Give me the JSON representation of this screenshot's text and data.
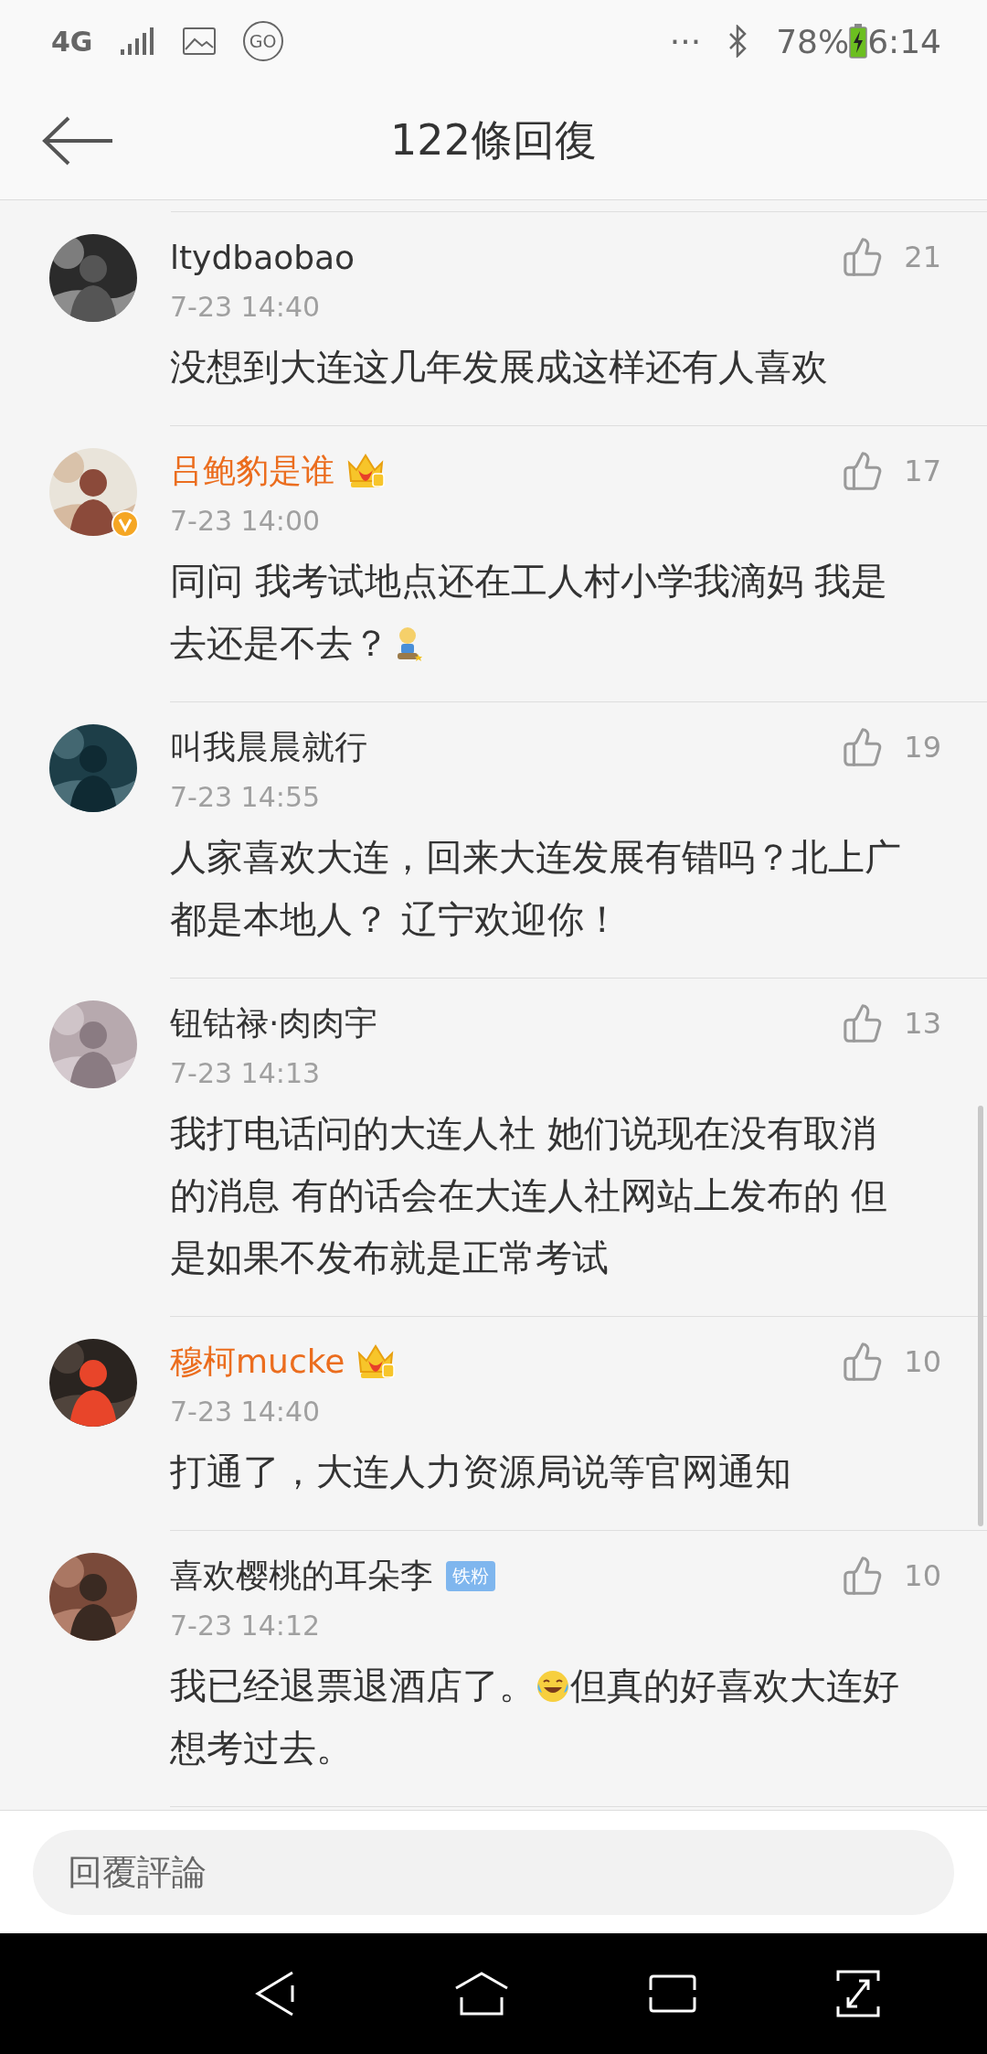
{
  "status_bar": {
    "network": "4G",
    "go": "GO",
    "more": "···",
    "battery": "78%",
    "time": "6:14"
  },
  "header": {
    "title": "122條回復"
  },
  "comments": [
    {
      "name": "ltydbaobao",
      "vip": false,
      "time": "7-23 14:40",
      "likes": "21",
      "body": [
        {
          "kind": "text",
          "text": "没想到大连这几年发展成这样还有人喜欢"
        }
      ]
    },
    {
      "name": "吕鲍豹是谁",
      "vip": true,
      "verified": true,
      "time": "7-23 14:00",
      "likes": "17",
      "body": [
        {
          "kind": "text",
          "text": "同问 我考试地点还在工人村小学我滴妈 我是"
        },
        {
          "kind": "text",
          "text": "去还是不去？"
        },
        {
          "kind": "sitting-emoji"
        }
      ]
    },
    {
      "name": "叫我晨晨就行",
      "vip": false,
      "time": "7-23 14:55",
      "likes": "19",
      "body": [
        {
          "kind": "text",
          "text": "人家喜欢大连，回来大连发展有错吗？北上广都是本地人？ 辽宁欢迎你！"
        }
      ]
    },
    {
      "name": "钮钴禄·肉肉宇",
      "vip": false,
      "time": "7-23 14:13",
      "likes": "13",
      "body": [
        {
          "kind": "text",
          "text": "我打电话问的大连人社 她们说现在没有取消的消息 有的话会在大连人社网站上发布的 但是如果不发布就是正常考试"
        }
      ]
    },
    {
      "name": "穆柯mucke",
      "vip": true,
      "time": "7-23 14:40",
      "likes": "10",
      "body": [
        {
          "kind": "text",
          "text": "打通了，大连人力资源局说等官网通知"
        }
      ]
    },
    {
      "name": "喜欢樱桃的耳朵李",
      "vip": false,
      "badge": "铁粉",
      "time": "7-23 14:12",
      "likes": "10",
      "body": [
        {
          "kind": "text",
          "text": "我已经退票退酒店了。"
        },
        {
          "kind": "laughing-emoji"
        },
        {
          "kind": "text",
          "text": "但真的好喜欢大连好"
        },
        {
          "kind": "text",
          "text": "想考过去。"
        }
      ]
    }
  ],
  "reply": {
    "placeholder": "回覆評論"
  }
}
